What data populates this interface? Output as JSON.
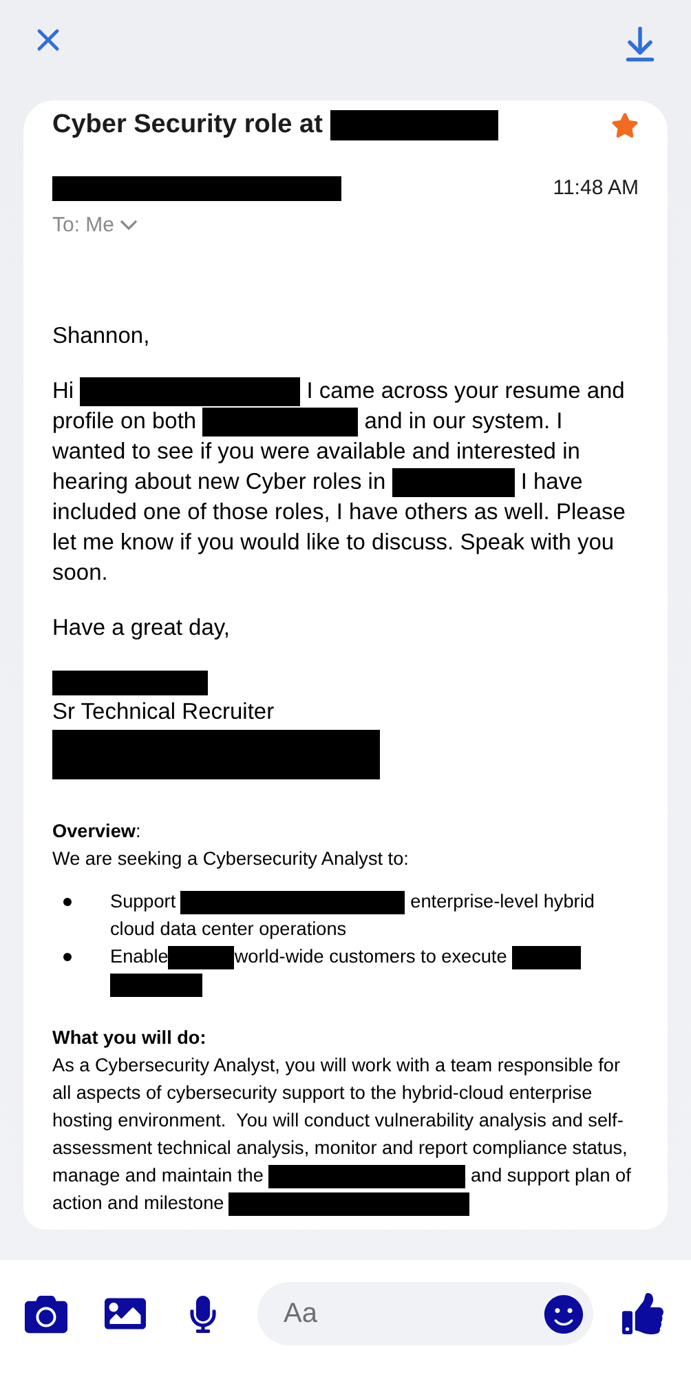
{
  "email": {
    "subject": [
      {
        "kind": "text",
        "text": "Cyber Security role at "
      },
      {
        "kind": "redaction"
      }
    ],
    "starred": true,
    "sender": {
      "kind": "redaction"
    },
    "time": "11:48 AM",
    "recipient": "To: Me"
  },
  "body": [
    {
      "kind": "paragraph",
      "segments": [
        {
          "kind": "text",
          "text": "Shannon,"
        }
      ]
    },
    {
      "kind": "paragraph",
      "segments": [
        {
          "kind": "text",
          "text": "Hi "
        },
        {
          "kind": "redaction"
        },
        {
          "kind": "text",
          "text": " I came across your resume and profile on both "
        },
        {
          "kind": "redaction"
        },
        {
          "kind": "text",
          "text": " and in our system. I wanted to see if you were available and interested in hearing about new Cyber roles in "
        },
        {
          "kind": "redaction"
        },
        {
          "kind": "text",
          "text": " I have included one of those roles, I have others as well. Please let me know if you would like to discuss. Speak with you soon."
        }
      ]
    },
    {
      "kind": "paragraph",
      "segments": [
        {
          "kind": "text",
          "text": "Have a great day,"
        }
      ]
    },
    {
      "kind": "signature",
      "lines": [
        {
          "kind": "redaction"
        },
        {
          "kind": "text",
          "text": "Sr Technical Recruiter"
        },
        {
          "kind": "redaction"
        }
      ]
    },
    {
      "kind": "section",
      "heading": [
        {
          "text": "Overview",
          "bold": true
        },
        {
          "text": ":",
          "bold": false
        }
      ],
      "intro": "We are seeking a Cybersecurity Analyst to:",
      "bullets": [
        [
          {
            "kind": "text",
            "text": "Support "
          },
          {
            "kind": "redaction"
          },
          {
            "kind": "text",
            "text": " enterprise-level hybrid cloud data center operations"
          }
        ],
        [
          {
            "kind": "text",
            "text": "Enable"
          },
          {
            "kind": "redaction"
          },
          {
            "kind": "text",
            "text": "world-wide customers to execute "
          },
          {
            "kind": "redaction"
          },
          {
            "kind": "redaction"
          }
        ]
      ]
    },
    {
      "kind": "section",
      "heading": [
        {
          "text": "What you will do:",
          "bold": true
        }
      ],
      "paragraph": [
        {
          "kind": "text",
          "text": "As a Cybersecurity Analyst, you will work with a team responsible for all aspects of cybersecurity support to the hybrid-cloud enterprise hosting environment.  You will conduct vulnerability analysis and self-assessment technical analysis, monitor and report compliance status, manage and maintain the "
        },
        {
          "kind": "redaction"
        },
        {
          "kind": "text",
          "text": " and support plan of action and milestone "
        },
        {
          "kind": "redaction"
        }
      ]
    }
  ],
  "composer": {
    "placeholder": "Aa"
  }
}
